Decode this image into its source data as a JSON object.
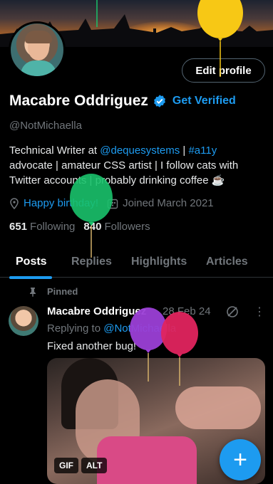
{
  "profile": {
    "display_name": "Macabre Oddriguez",
    "get_verified": "Get Verified",
    "handle": "@NotMichaella",
    "edit_profile": "Edit profile",
    "bio": {
      "prefix": "Technical Writer at ",
      "mention": "@dequesystems",
      "sep": " | ",
      "hashtag": "#a11y",
      "rest": " advocate | amateur CSS artist | I follow cats with Twitter accounts | probably drinking coffee ☕"
    },
    "birthday": "Happy birthday!",
    "joined": "Joined March 2021",
    "following_count": "651",
    "following_label": "Following",
    "followers_count": "840",
    "followers_label": "Followers"
  },
  "tabs": [
    "Posts",
    "Replies",
    "Highlights",
    "Articles"
  ],
  "pinned_post": {
    "pinned_label": "Pinned",
    "author": "Macabre Oddriguez",
    "date": "28 Feb 24",
    "more": "⋮",
    "replying_to": "Replying to ",
    "reply_handle": "@NotMichaella",
    "text": "Fixed another bug!",
    "badges": {
      "gif": "GIF",
      "alt": "ALT"
    }
  },
  "fab": {
    "label": "+"
  },
  "colors": {
    "accent": "#1d9bf0",
    "balloon_yellow": "#f7c815",
    "balloon_green": "#19c26b",
    "balloon_purple": "#9b3fd6",
    "balloon_pink": "#e0245e"
  }
}
